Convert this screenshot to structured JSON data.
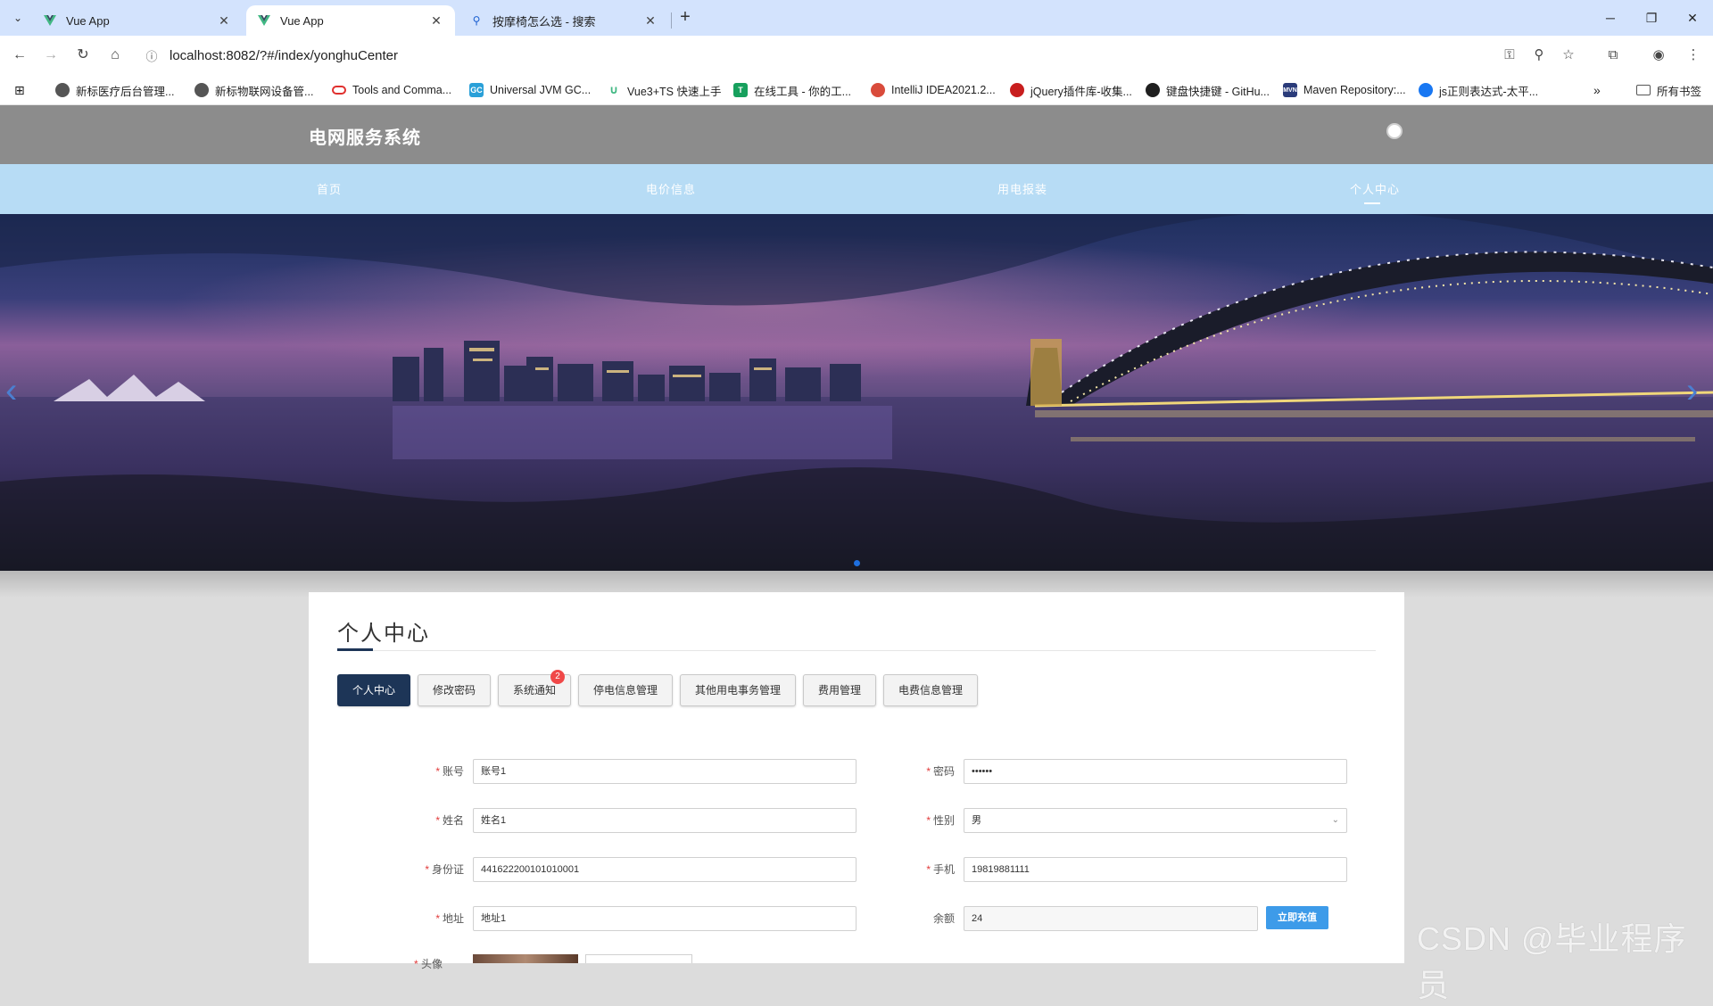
{
  "browser": {
    "tabs": [
      {
        "title": "Vue App",
        "active": false
      },
      {
        "title": "Vue App",
        "active": true
      },
      {
        "title": "按摩椅怎么选 - 搜索",
        "active": false
      }
    ],
    "url": "localhost:8082/?#/index/yonghuCenter",
    "bookmarks": [
      {
        "label": "新标医疗后台管理...",
        "icon": "globe-icon"
      },
      {
        "label": "新标物联网设备管...",
        "icon": "globe-icon"
      },
      {
        "label": "Tools and Comma...",
        "icon": "oracle-icon"
      },
      {
        "label": "Universal JVM GC...",
        "icon": "gc-icon"
      },
      {
        "label": "Vue3+TS 快速上手",
        "icon": "vue-icon"
      },
      {
        "label": "在线工具 - 你的工...",
        "icon": "tool-icon"
      },
      {
        "label": "IntelliJ IDEA2021.2...",
        "icon": "chrome-icon"
      },
      {
        "label": "jQuery插件库-收集...",
        "icon": "jquery-icon"
      },
      {
        "label": "键盘快捷键 - GitHu...",
        "icon": "github-icon"
      },
      {
        "label": "Maven Repository:...",
        "icon": "maven-icon"
      },
      {
        "label": "js正则表达式-太平...",
        "icon": "edge-icon"
      }
    ],
    "all_bookmarks": "所有书签"
  },
  "site": {
    "title": "电网服务系统",
    "nav": [
      "首页",
      "电价信息",
      "用电报装",
      "个人中心"
    ],
    "active_nav": "个人中心"
  },
  "center": {
    "title": "个人中心",
    "tabs": [
      "个人中心",
      "修改密码",
      "系统通知",
      "停电信息管理",
      "其他用电事务管理",
      "费用管理",
      "电费信息管理"
    ],
    "notice_badge": "2",
    "form": {
      "account_label": "账号",
      "account_value": "账号1",
      "password_label": "密码",
      "password_value": "••••••",
      "name_label": "姓名",
      "name_value": "姓名1",
      "gender_label": "性别",
      "gender_value": "男",
      "id_label": "身份证",
      "id_value": "441622200101010001",
      "phone_label": "手机",
      "phone_value": "19819881111",
      "address_label": "地址",
      "address_value": "地址1",
      "balance_label": "余额",
      "balance_value": "24",
      "recharge_label": "立即充值",
      "avatar_label": "头像"
    }
  },
  "watermark": "CSDN @毕业程序员",
  "colors": {
    "header_bg": "#8c8c8c",
    "nav_bg": "#b7dcf5",
    "active_tab": "#1d3557",
    "recharge": "#3d9be9",
    "badge": "#f04848"
  }
}
